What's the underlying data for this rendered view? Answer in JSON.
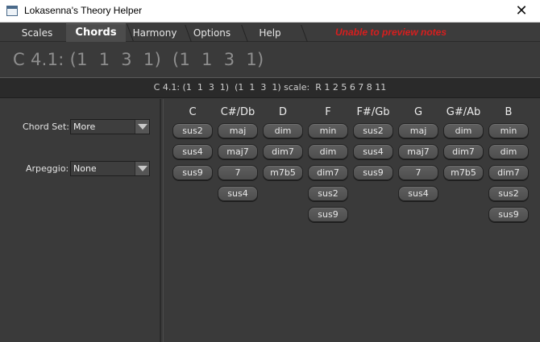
{
  "window": {
    "title": "Lokasenna's Theory Helper",
    "close_glyph": "✕"
  },
  "tabs": [
    {
      "label": "Scales",
      "active": false
    },
    {
      "label": "Chords",
      "active": true
    },
    {
      "label": "Harmony",
      "active": false
    },
    {
      "label": "Options",
      "active": false
    },
    {
      "label": "Help",
      "active": false
    }
  ],
  "status_message": "Unable to preview notes",
  "heading": "C 4.1: (1  1  3  1)  (1  1  3  1)",
  "info_line": "C 4.1: (1  1  3  1)  (1  1  3  1) scale:  R 1 2 5 6 7 8 11",
  "controls": {
    "chord_set_label": "Chord Set:",
    "chord_set_value": "More",
    "arpeggio_label": "Arpeggio:",
    "arpeggio_value": "None"
  },
  "columns": [
    {
      "root": "C",
      "chords": [
        "sus2",
        "sus4",
        "sus9"
      ]
    },
    {
      "root": "C#/Db",
      "chords": [
        "maj",
        "maj7",
        "7",
        "sus4"
      ]
    },
    {
      "root": "D",
      "chords": [
        "dim",
        "dim7",
        "m7b5"
      ]
    },
    {
      "root": "F",
      "chords": [
        "min",
        "dim",
        "dim7",
        "sus2",
        "sus9"
      ]
    },
    {
      "root": "F#/Gb",
      "chords": [
        "sus2",
        "sus4",
        "sus9"
      ]
    },
    {
      "root": "G",
      "chords": [
        "maj",
        "maj7",
        "7",
        "sus4"
      ]
    },
    {
      "root": "G#/Ab",
      "chords": [
        "dim",
        "dim7",
        "m7b5"
      ]
    },
    {
      "root": "B",
      "chords": [
        "min",
        "dim",
        "dim7",
        "sus2",
        "sus9"
      ]
    }
  ],
  "colors": {
    "status_red": "#d81e1e",
    "background": "#3a3a3a",
    "button": "#555555"
  }
}
